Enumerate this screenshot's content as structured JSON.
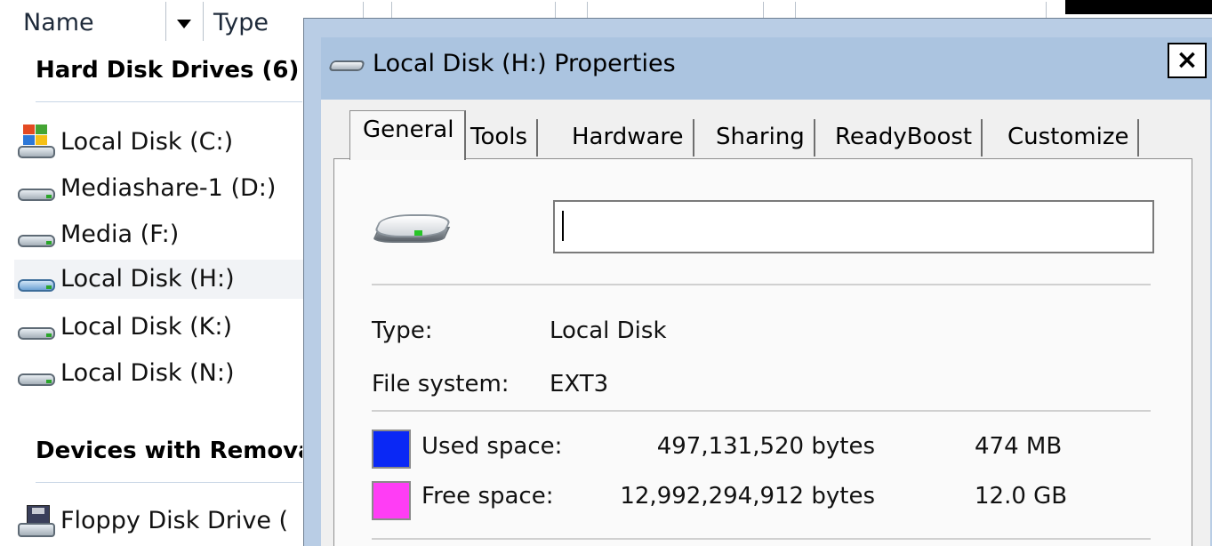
{
  "explorer": {
    "columns": {
      "name": "Name",
      "type": "Type"
    },
    "groups": [
      {
        "title": "Hard Disk Drives (6)"
      },
      {
        "title": "Devices with Removable Storage"
      }
    ],
    "drives": [
      {
        "label": "Local Disk (C:)",
        "icon": "windows-drive-icon"
      },
      {
        "label": "Mediashare-1 (D:)",
        "icon": "hard-drive-icon"
      },
      {
        "label": "Media (F:)",
        "icon": "hard-drive-icon"
      },
      {
        "label": "Local Disk (H:)",
        "icon": "hard-drive-icon",
        "selected": true
      },
      {
        "label": "Local Disk (K:)",
        "icon": "hard-drive-icon"
      },
      {
        "label": "Local Disk (N:)",
        "icon": "hard-drive-icon"
      }
    ],
    "removable": [
      {
        "label": "Floppy Disk Drive (",
        "icon": "floppy-drive-icon"
      }
    ]
  },
  "dialog": {
    "title": "Local Disk (H:) Properties",
    "close_label": "×",
    "tabs": [
      {
        "label": "General",
        "active": true
      },
      {
        "label": "Tools"
      },
      {
        "label": "Hardware"
      },
      {
        "label": "Sharing"
      },
      {
        "label": "ReadyBoost"
      },
      {
        "label": "Customize"
      }
    ],
    "general": {
      "name_value": "",
      "type_label": "Type:",
      "type_value": "Local Disk",
      "fs_label": "File system:",
      "fs_value": "EXT3",
      "used": {
        "label": "Used space:",
        "bytes": "497,131,520 bytes",
        "size": "474 MB",
        "color": "#0a28f5"
      },
      "free": {
        "label": "Free space:",
        "bytes": "12,992,294,912 bytes",
        "size": "12.0 GB",
        "color": "#ff3df5"
      }
    }
  }
}
